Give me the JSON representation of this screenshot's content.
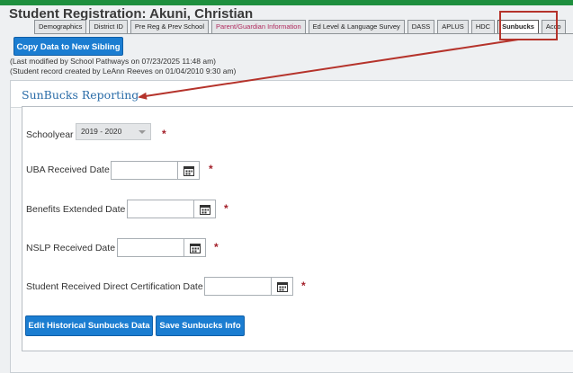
{
  "page": {
    "title": "Student Registration: Akuni, Christian"
  },
  "tabs": [
    {
      "label": "Demographics"
    },
    {
      "label": "District ID"
    },
    {
      "label": "Pre Reg & Prev School"
    },
    {
      "label": "Parent/Guardian Information"
    },
    {
      "label": "Ed Level & Language Survey"
    },
    {
      "label": "DASS"
    },
    {
      "label": "APLUS"
    },
    {
      "label": "HDC"
    },
    {
      "label": "Sunbucks"
    },
    {
      "label": "Acco"
    }
  ],
  "active_tab": "Sunbucks",
  "actions": {
    "copy_sibling": "Copy Data to New Sibling"
  },
  "meta": {
    "last_modified": "(Last modified by School Pathways on 07/23/2025 11:48 am)",
    "created": "(Student record created by LeAnn Reeves on 01/04/2010 9:30 am)"
  },
  "panel": {
    "title": "SunBucks Reporting"
  },
  "form": {
    "schoolyear_label": "Schoolyear",
    "schoolyear_value": "2019 - 2020",
    "uba_label": "UBA Received Date",
    "uba_value": "",
    "benefits_label": "Benefits Extended Date",
    "benefits_value": "",
    "nslp_label": "NSLP Received Date",
    "nslp_value": "",
    "direct_cert_label": "Student Received Direct Certification Date",
    "direct_cert_value": "",
    "required_mark": "*"
  },
  "buttons": {
    "edit_historical": "Edit Historical Sunbucks Data",
    "save": "Save Sunbucks Info"
  },
  "colors": {
    "header_bar": "#1e8f3e",
    "button_blue": "#1b7dd1",
    "panel_title": "#2a6ca8",
    "required": "#a3202a",
    "annotation_red": "#b5332b"
  },
  "icons": {
    "calendar": "calendar-icon",
    "dropdown": "chevron-down-icon"
  }
}
